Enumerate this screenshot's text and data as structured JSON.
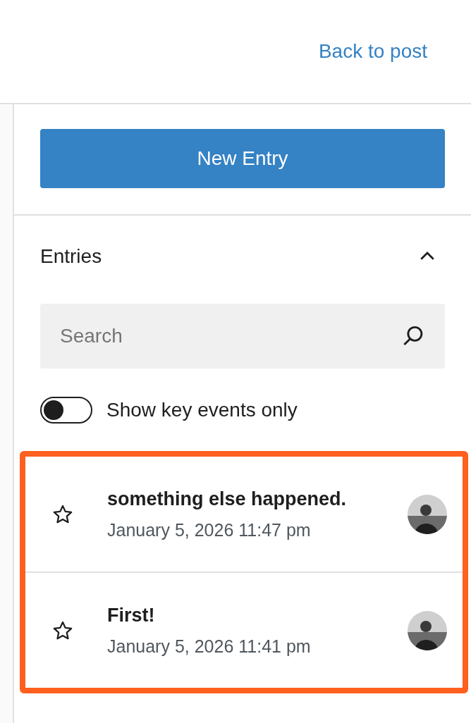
{
  "header": {
    "back_link": "Back to post"
  },
  "new_entry_button": "New Entry",
  "entries_panel": {
    "title": "Entries",
    "expanded": true,
    "search": {
      "placeholder": "Search"
    },
    "key_events_toggle": {
      "label": "Show key events only",
      "on": false
    },
    "entries": [
      {
        "title": "something else happened.",
        "date": "January 5, 2026 11:47 pm",
        "starred": false
      },
      {
        "title": "First!",
        "date": "January 5, 2026 11:41 pm",
        "starred": false
      }
    ]
  }
}
